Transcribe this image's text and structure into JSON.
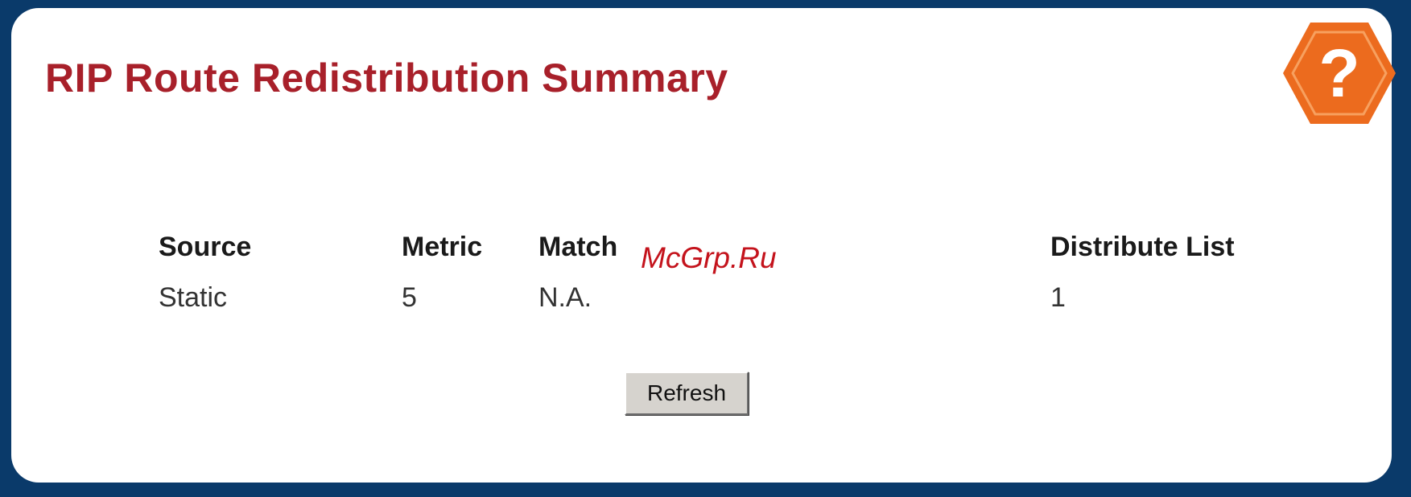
{
  "page": {
    "title": "RIP Route Redistribution Summary"
  },
  "help": {
    "icon": "help-question-icon",
    "glyph": "?",
    "color": "#ec6b1e"
  },
  "table": {
    "headers": {
      "source": "Source",
      "metric": "Metric",
      "match": "Match",
      "distribute_list": "Distribute List"
    },
    "rows": [
      {
        "source": "Static",
        "metric": "5",
        "match": "N.A.",
        "distribute_list": "1"
      }
    ]
  },
  "actions": {
    "refresh_label": "Refresh"
  },
  "watermark": {
    "text": "McGrp.Ru"
  },
  "colors": {
    "title": "#a8202a",
    "frame": "#0a3a6a",
    "watermark": "#c4131c"
  }
}
